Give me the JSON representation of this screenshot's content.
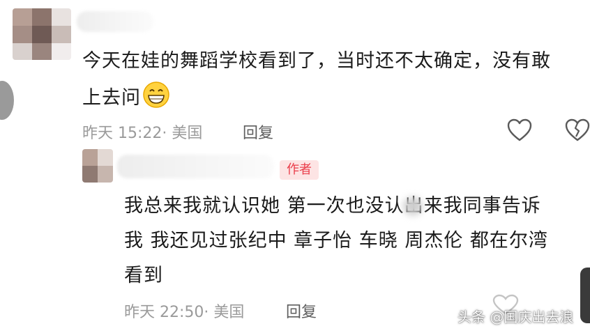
{
  "comments": [
    {
      "text_line1": "今天在娃的舞蹈学校看到了，当时还不太确定，没有敢",
      "text_line2": "上去问",
      "emoji": "grinning-face-emoji",
      "time": "昨天 15:22",
      "location": "· 美国",
      "reply_label": "回复",
      "icons": [
        "heart-icon",
        "dislike-heart-icon"
      ]
    }
  ],
  "reply": {
    "author_badge": "作者",
    "text_line1": "我总来我就认识她 第一次也没认出来我同事告诉",
    "text_line2": "我 我还见过张纪中 章子怡 车晓 周杰伦 都在尔湾",
    "text_line3": "看到",
    "time": "昨天 22:50",
    "location": "· 美国",
    "reply_label": "回复"
  },
  "watermark": "头条 @国庆出去浪",
  "colors": {
    "text": "#1b1b1b",
    "meta": "#9a9a9a",
    "badge_bg": "#fde4e4",
    "badge_text": "#ea3d4a"
  }
}
